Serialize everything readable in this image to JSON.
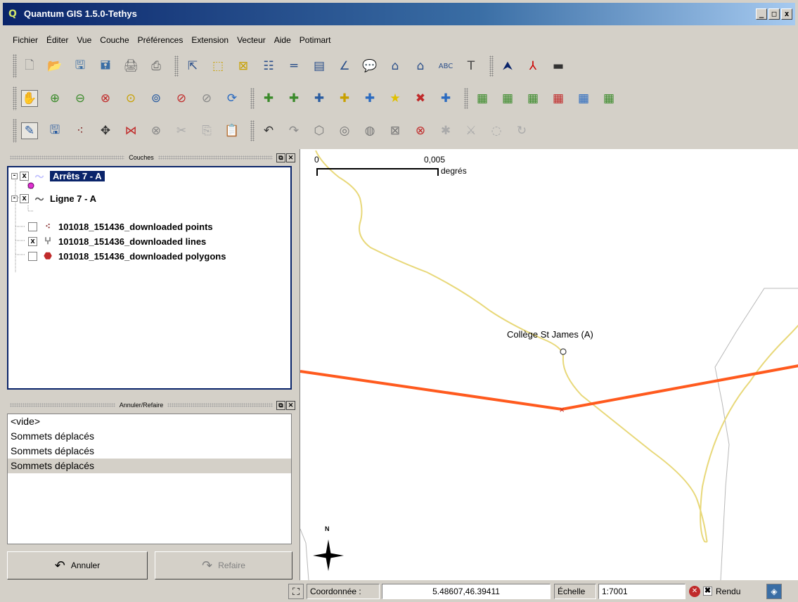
{
  "window": {
    "logo": "Q",
    "title": "Quantum GIS 1.5.0-Tethys",
    "controls": [
      "_",
      "□",
      "x"
    ]
  },
  "menu": [
    {
      "label": "Fichier"
    },
    {
      "label": "Éditer"
    },
    {
      "label": "Vue"
    },
    {
      "label": "Couche"
    },
    {
      "label": "Préférences"
    },
    {
      "label": "Extension"
    },
    {
      "label": "Vecteur"
    },
    {
      "label": "Aide"
    },
    {
      "label": "Potimart"
    }
  ],
  "toolbars": {
    "file": [
      "new-project-icon",
      "open-project-icon",
      "save-project-icon",
      "save-as-icon",
      "print-composer-icon",
      "print-icon",
      "identify-icon",
      "select-features-icon",
      "deselect-icon",
      "attribute-table-icon",
      "measure-line-icon",
      "measure-area-icon",
      "measure-angle-icon",
      "map-tips-icon",
      "home-icon",
      "home-new-icon",
      "spelling-icon",
      "text-annotation-icon",
      "north-arrow-icon",
      "pdf-icon",
      "scalebar-icon"
    ],
    "nav": [
      "pan-icon",
      "zoom-in-icon",
      "zoom-out-icon",
      "zoom-full-icon",
      "zoom-selection-icon",
      "zoom-layer-icon",
      "zoom-last-icon",
      "zoom-actual-icon",
      "refresh-icon",
      "add-vector-icon",
      "add-raster-icon",
      "add-postgis-icon",
      "add-spatialite-icon",
      "add-wms-icon",
      "new-vector-icon",
      "remove-layer-icon",
      "add-wfs-icon",
      "show-all-layers-icon",
      "hide-all-layers-icon",
      "show-layer-icon",
      "hide-layer-icon",
      "overview-icon",
      "overview-all-icon"
    ],
    "edit": [
      "toggle-editing-icon",
      "save-edits-icon",
      "capture-point-icon",
      "move-feature-icon",
      "node-tool-icon",
      "delete-selected-icon",
      "cut-features-icon",
      "copy-features-icon",
      "paste-features-icon",
      "undo-edit-icon",
      "redo-edit-icon",
      "simplify-icon",
      "add-ring-icon",
      "add-island-icon",
      "delete-ring-icon",
      "delete-part-icon",
      "reshape-icon",
      "split-features-icon",
      "merge-icon",
      "rotate-point-icon"
    ]
  },
  "layers_dock": {
    "title": "Couches",
    "layers": [
      {
        "name": "Arrêts 7 - A",
        "expander": "-",
        "checked": "x",
        "selected": true
      },
      {
        "name": "Ligne 7 - A",
        "expander": "-",
        "checked": "x",
        "selected": false
      },
      {
        "name": "101018_151436_downloaded points",
        "expander": "",
        "checked": "",
        "selected": false
      },
      {
        "name": "101018_151436_downloaded lines",
        "expander": "",
        "checked": "x",
        "selected": false
      },
      {
        "name": "101018_151436_downloaded polygons",
        "expander": "",
        "checked": "",
        "selected": false
      }
    ]
  },
  "undo_dock": {
    "title": "Annuler/Refaire",
    "items": [
      "<vide>",
      "Sommets déplacés",
      "Sommets déplacés",
      "Sommets déplacés"
    ],
    "undo_label": "Annuler",
    "redo_label": "Refaire"
  },
  "map": {
    "scale_start": "0",
    "scale_end": "0,005",
    "scale_unit": "degrés",
    "label": "Collège St James (A)",
    "north": "N",
    "colors": {
      "route": "#ff5a1e",
      "road": "#e8d879",
      "boundary": "#b8b8b8"
    }
  },
  "status": {
    "coord_label": "Coordonnée :",
    "coord_value": "5.48607,46.39411",
    "scale_label": "Échelle",
    "scale_value": "1:7001",
    "render_label": "Rendu"
  }
}
